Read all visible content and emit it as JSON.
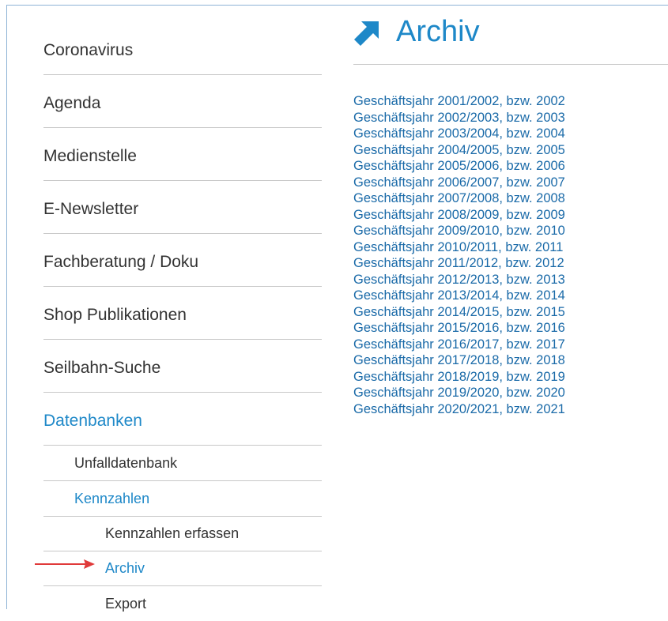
{
  "colors": {
    "accent": "#1e88c8",
    "link": "#1a6aa8",
    "text": "#333333",
    "divider": "#c8c8c8",
    "annotation_arrow": "#e03a3a"
  },
  "sidebar": {
    "items": [
      {
        "label": "Coronavirus"
      },
      {
        "label": "Agenda"
      },
      {
        "label": "Medienstelle"
      },
      {
        "label": "E-Newsletter"
      },
      {
        "label": "Fachberatung / Doku"
      },
      {
        "label": "Shop Publikationen"
      },
      {
        "label": "Seilbahn-Suche"
      },
      {
        "label": "Datenbanken",
        "active": true
      }
    ],
    "sub_items": [
      {
        "label": "Unfalldatenbank"
      },
      {
        "label": "Kennzahlen",
        "active": true
      }
    ],
    "sub_sub_items": [
      {
        "label": "Kennzahlen erfassen"
      },
      {
        "label": "Archiv",
        "active": true
      },
      {
        "label": "Export"
      }
    ]
  },
  "main": {
    "icon": "arrow-up-right-icon",
    "title": "Archiv",
    "years": [
      "Geschäftsjahr 2001/2002, bzw. 2002",
      "Geschäftsjahr 2002/2003, bzw. 2003",
      "Geschäftsjahr 2003/2004, bzw. 2004",
      "Geschäftsjahr 2004/2005, bzw. 2005",
      "Geschäftsjahr 2005/2006, bzw. 2006",
      "Geschäftsjahr 2006/2007, bzw. 2007",
      "Geschäftsjahr 2007/2008, bzw. 2008",
      "Geschäftsjahr 2008/2009, bzw. 2009",
      "Geschäftsjahr 2009/2010, bzw. 2010",
      "Geschäftsjahr 2010/2011, bzw. 2011",
      "Geschäftsjahr 2011/2012, bzw. 2012",
      "Geschäftsjahr 2012/2013, bzw. 2013",
      "Geschäftsjahr 2013/2014, bzw. 2014",
      "Geschäftsjahr 2014/2015, bzw. 2015",
      "Geschäftsjahr 2015/2016, bzw. 2016",
      "Geschäftsjahr 2016/2017, bzw. 2017",
      "Geschäftsjahr 2017/2018, bzw. 2018",
      "Geschäftsjahr 2018/2019, bzw. 2019",
      "Geschäftsjahr 2019/2020, bzw. 2020",
      "Geschäftsjahr 2020/2021, bzw. 2021"
    ]
  }
}
